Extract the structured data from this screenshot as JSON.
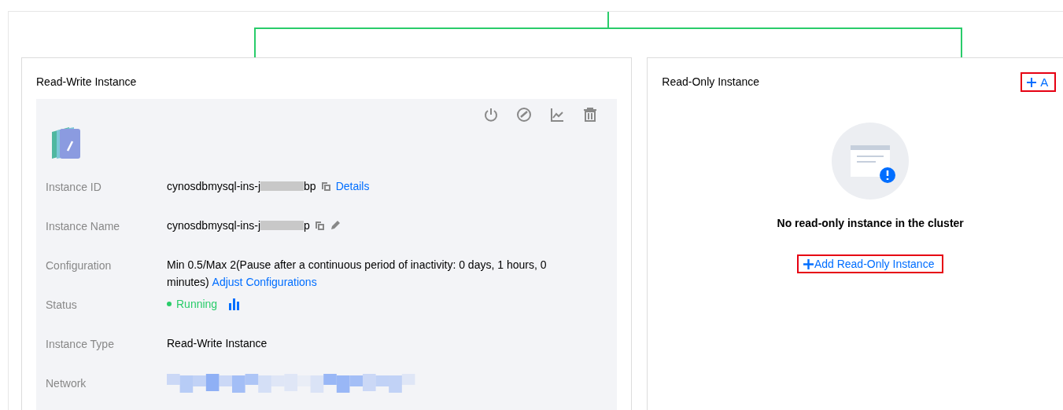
{
  "read_write": {
    "title": "Read-Write Instance",
    "rows": [
      {
        "kind": "id",
        "label": "Instance ID",
        "prefix": "cynosdbmysql-ins-j",
        "suffix": "bp",
        "link": "Details"
      },
      {
        "kind": "name",
        "label": "Instance Name",
        "prefix": "cynosdbmysql-ins-j",
        "suffix": "p"
      },
      {
        "kind": "config",
        "label": "Configuration",
        "value": "Min 0.5/Max 2(Pause after a continuous period of inactivity: 0 days, 1 hours, 0 minutes)",
        "link": "Adjust Configurations"
      },
      {
        "kind": "status",
        "label": "Status",
        "value": "Running",
        "color": "#29cc6a"
      },
      {
        "kind": "text",
        "label": "Instance Type",
        "value": "Read-Write Instance"
      },
      {
        "kind": "redacted",
        "label": "Network"
      }
    ]
  },
  "read_only": {
    "title": "Read-Only Instance",
    "header_action": "A",
    "empty_text": "No read-only instance in the cluster",
    "add_button": "Add Read-Only Instance"
  }
}
